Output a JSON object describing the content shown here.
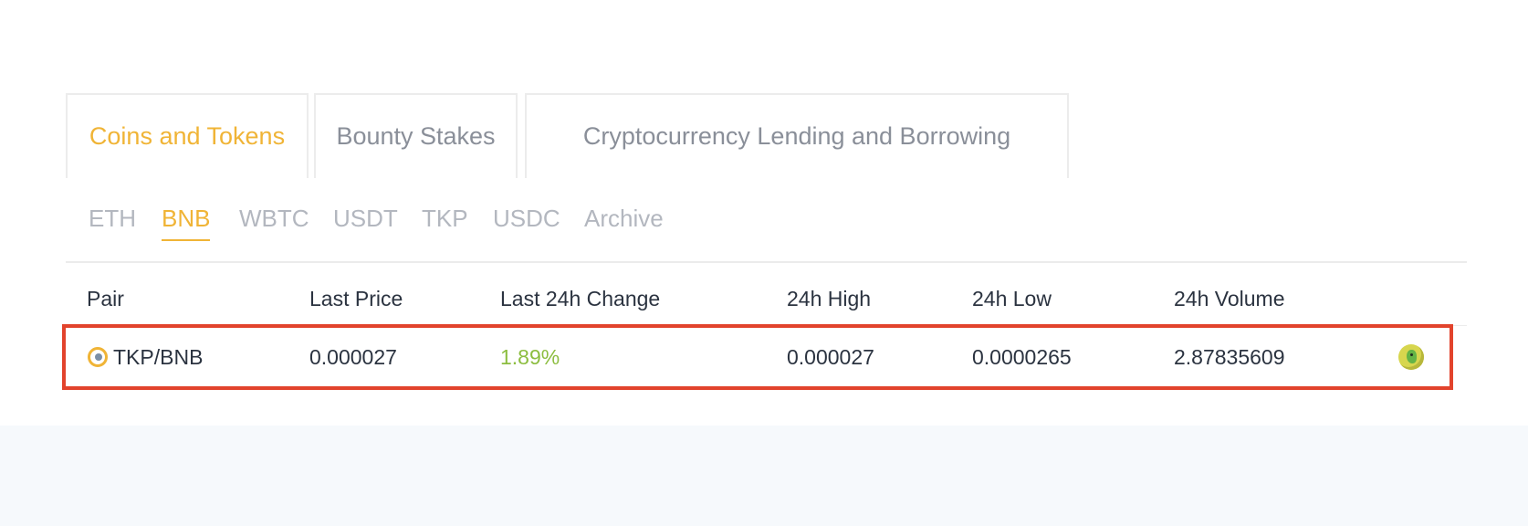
{
  "primary_tabs": [
    {
      "label": "Coins and Tokens",
      "active": true
    },
    {
      "label": "Bounty Stakes",
      "active": false
    },
    {
      "label": "Cryptocurrency Lending and Borrowing",
      "active": false
    }
  ],
  "sub_tabs": [
    {
      "label": "ETH",
      "active": false
    },
    {
      "label": "BNB",
      "active": true
    },
    {
      "label": "WBTC",
      "active": false
    },
    {
      "label": "USDT",
      "active": false
    },
    {
      "label": "TKP",
      "active": false
    },
    {
      "label": "USDC",
      "active": false
    },
    {
      "label": "Archive",
      "active": false
    }
  ],
  "table": {
    "columns": [
      "Pair",
      "Last Price",
      "Last 24h Change",
      "24h High",
      "24h Low",
      "24h Volume"
    ],
    "rows": [
      {
        "pair": "TKP/BNB",
        "pair_icon": "tkp-coin-icon",
        "last_price": "0.000027",
        "change": "1.89%",
        "high": "0.000027",
        "low": "0.0000265",
        "volume": "2.87835609",
        "action_icon": "dex-parrot-icon"
      }
    ]
  },
  "colors": {
    "accent": "#f0b436",
    "positive": "#8cbd3f",
    "highlight_border": "#e2432c",
    "footer_bg": "#f6f9fc"
  }
}
